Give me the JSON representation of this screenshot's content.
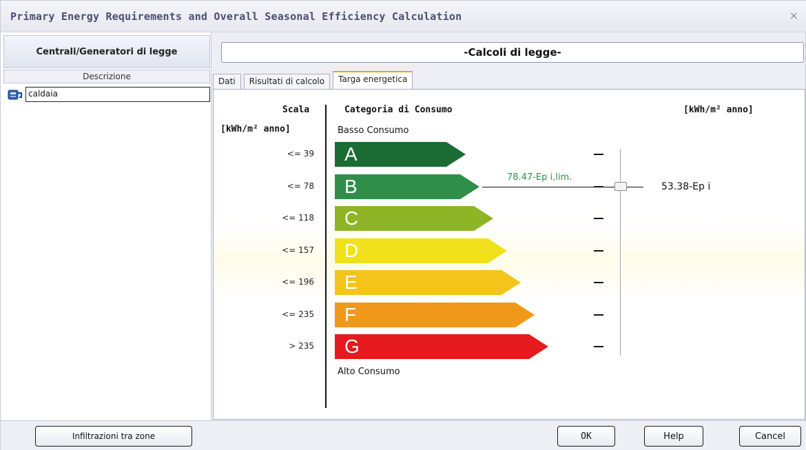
{
  "window": {
    "title": "Primary Energy Requirements and Overall Seasonal Efficiency Calculation",
    "close_glyph": "×"
  },
  "left": {
    "header": "Centrali/Generatori di legge",
    "column_header": "Descrizione",
    "items": [
      {
        "label": "caldaia",
        "icon": "boiler-icon"
      }
    ]
  },
  "right": {
    "header": "-Calcoli di legge-",
    "tabs": [
      {
        "label": "Dati",
        "active": false
      },
      {
        "label": "Risultati di calcolo",
        "active": false
      },
      {
        "label": "Targa energetica",
        "active": true
      }
    ]
  },
  "energy_label": {
    "scale_title": "Scala",
    "scale_unit": "[kWh/m² anno]",
    "category_title": "Categoria di Consumo",
    "unit_right": "[kWh/m² anno]",
    "low_label": "Basso Consumo",
    "high_label": "Alto Consumo",
    "limit_label": "78.47-Ep i,lim.",
    "value_label": "53.38-Ep i",
    "classes": [
      {
        "letter": "A",
        "threshold": "<= 39",
        "color": "#1a6b34"
      },
      {
        "letter": "B",
        "threshold": "<= 78",
        "color": "#2f8f4a"
      },
      {
        "letter": "C",
        "threshold": "<= 118",
        "color": "#8db526"
      },
      {
        "letter": "D",
        "threshold": "<= 157",
        "color": "#f1e11c"
      },
      {
        "letter": "E",
        "threshold": "<= 196",
        "color": "#f5c41a"
      },
      {
        "letter": "F",
        "threshold": "<= 235",
        "color": "#f0981a"
      },
      {
        "letter": "G",
        "threshold": "> 235",
        "color": "#e51a1e"
      }
    ]
  },
  "buttons": {
    "infiltrations": "Infiltrazioni tra zone",
    "ok": "OK",
    "help": "Help",
    "cancel": "Cancel"
  }
}
